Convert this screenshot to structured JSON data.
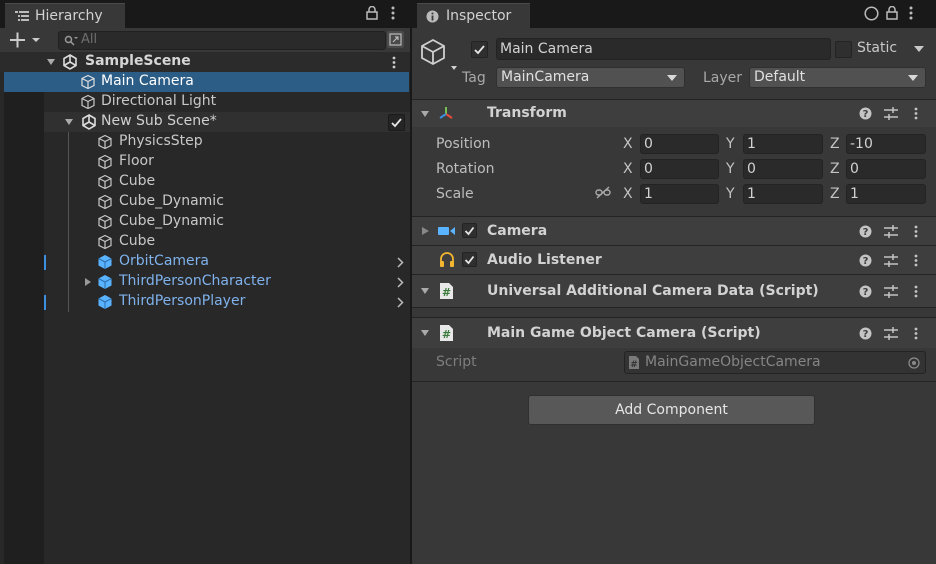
{
  "hierarchy": {
    "tab_label": "Hierarchy",
    "search_placeholder": "All",
    "scene_name": "SampleScene",
    "items": [
      {
        "label": "Main Camera"
      },
      {
        "label": "Directional Light"
      },
      {
        "label": "New Sub Scene*"
      },
      {
        "label": "PhysicsStep"
      },
      {
        "label": "Floor"
      },
      {
        "label": "Cube"
      },
      {
        "label": "Cube_Dynamic"
      },
      {
        "label": "Cube_Dynamic"
      },
      {
        "label": "Cube"
      },
      {
        "label": "OrbitCamera"
      },
      {
        "label": "ThirdPersonCharacter"
      },
      {
        "label": "ThirdPersonPlayer"
      }
    ]
  },
  "inspector": {
    "tab_label": "Inspector",
    "object_name": "Main Camera",
    "static_label": "Static",
    "tag_label": "Tag",
    "tag_value": "MainCamera",
    "layer_label": "Layer",
    "layer_value": "Default",
    "transform": {
      "title": "Transform",
      "position_label": "Position",
      "rotation_label": "Rotation",
      "scale_label": "Scale",
      "axis_x": "X",
      "axis_y": "Y",
      "axis_z": "Z",
      "position": {
        "x": "0",
        "y": "1",
        "z": "-10"
      },
      "rotation": {
        "x": "0",
        "y": "0",
        "z": "0"
      },
      "scale": {
        "x": "1",
        "y": "1",
        "z": "1"
      }
    },
    "components": {
      "camera": "Camera",
      "audio_listener": "Audio Listener",
      "urp_camera_data": "Universal Additional Camera Data (Script)",
      "main_game_object_camera": "Main Game Object Camera (Script)"
    },
    "script_label": "Script",
    "script_value": "MainGameObjectCamera",
    "add_component_label": "Add Component"
  },
  "colors": {
    "selection": "#2c5d87",
    "prefab_text": "#7fb2ec",
    "prefab_icon": "#5ab3ff"
  }
}
